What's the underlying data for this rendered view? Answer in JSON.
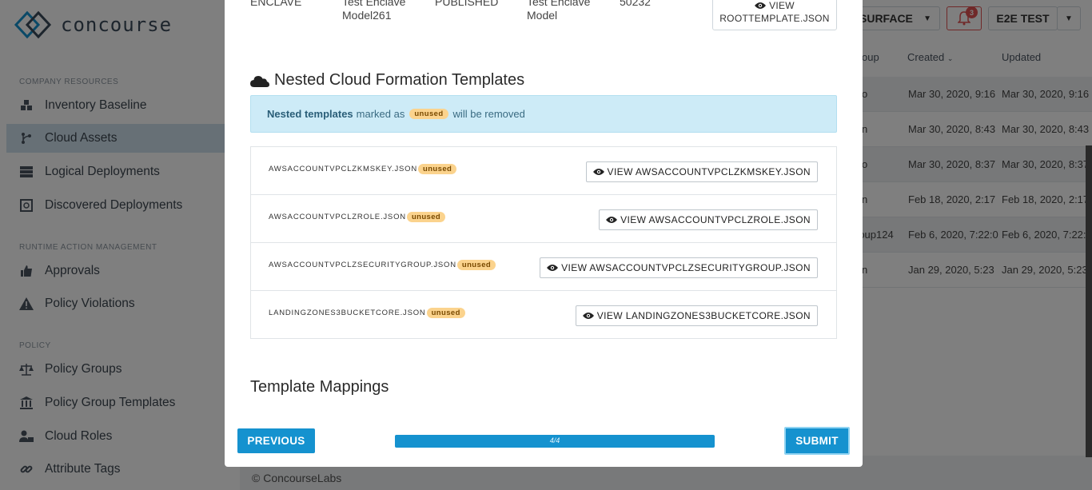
{
  "app": {
    "logo_text": "concourse"
  },
  "sidebar": {
    "sections": [
      {
        "title": "COMPANY RESOURCES"
      },
      {
        "title": "RUNTIME ACTION MANAGEMENT"
      },
      {
        "title": "POLICY"
      }
    ],
    "items": [
      {
        "label": "Inventory Baseline",
        "icon": "cubes-icon"
      },
      {
        "label": "Cloud Assets",
        "icon": "branch-icon",
        "active": true
      },
      {
        "label": "Logical Deployments",
        "icon": "server-icon"
      },
      {
        "label": "Discovered Deployments",
        "icon": "search-file-icon"
      },
      {
        "label": "Approvals",
        "icon": "thumbs-up-icon"
      },
      {
        "label": "Policy Violations",
        "icon": "warning-icon"
      },
      {
        "label": "Policy Groups",
        "icon": "scale-icon"
      },
      {
        "label": "Policy Group Templates",
        "icon": "bank-icon"
      },
      {
        "label": "Cloud Roles",
        "icon": "user-lock-icon"
      },
      {
        "label": "Attribute Tags",
        "icon": "link-icon"
      }
    ]
  },
  "header": {
    "surface_label": "SURFACE",
    "notification_count": "3",
    "user_label": "E2E TEST"
  },
  "table": {
    "columns": {
      "group_partial": "oup",
      "created": "Created",
      "updated": "Updated"
    },
    "rows": [
      {
        "group": "o",
        "created": "Mar 30, 2020, 9:16",
        "updated": "Mar 30, 2020, 9:16"
      },
      {
        "group": "n",
        "created": "Mar 30, 2020, 8:43",
        "updated": "Mar 30, 2020, 8:43"
      },
      {
        "group": "o",
        "created": "Mar 30, 2020, 8:37",
        "updated": "Mar 30, 2020, 8:37"
      },
      {
        "group": "n",
        "created": "Feb 18, 2020, 2:17",
        "updated": "Feb 18, 2020, 2:17"
      },
      {
        "group": "roup124",
        "created": "Feb 6, 2020, 7:22:0",
        "updated": "Feb 6, 2020, 7:22:0"
      },
      {
        "group": "n",
        "created": "Jan 29, 2020, 5:23",
        "updated": "Jan 29, 2020, 5:23"
      }
    ]
  },
  "footer": {
    "text": "© ConcourseLabs"
  },
  "modal": {
    "summary_row": {
      "type": "ENCLAVE",
      "name_line1": "Test Enclave",
      "name_line2": "Model261",
      "status": "PUBLISHED",
      "desc_line1": "Test Enclave",
      "desc_line2": "Model",
      "version": "50232",
      "view_line1": "VIEW",
      "view_line2": "ROOTTEMPLATE.JSON"
    },
    "nested_title": "Nested Cloud Formation Templates",
    "info": {
      "bold": "Nested templates",
      "pre": "marked as",
      "pill": "unused",
      "post": "will be removed"
    },
    "templates": [
      {
        "name": "AWSACCOUNTVPCLZKMSKEY.JSON",
        "tag": "unused",
        "button": "VIEW AWSACCOUNTVPCLZKMSKEY.JSON"
      },
      {
        "name": "AWSACCOUNTVPCLZROLE.JSON",
        "tag": "unused",
        "button": "VIEW AWSACCOUNTVPCLZROLE.JSON"
      },
      {
        "name": "AWSACCOUNTVPCLZSECURITYGROUP.JSON",
        "tag": "unused",
        "button": "VIEW AWSACCOUNTVPCLZSECURITYGROUP.JSON"
      },
      {
        "name": "LANDINGZONES3BUCKETCORE.JSON",
        "tag": "unused",
        "button": "VIEW LANDINGZONES3BUCKETCORE.JSON"
      }
    ],
    "mappings_title": "Template Mappings",
    "previous_label": "PREVIOUS",
    "progress_text": "4/4",
    "progress_fraction": 1.0,
    "submit_label": "SUBMIT"
  },
  "colors": {
    "accent": "#1592cf",
    "info_bg": "#cdebf7",
    "pill_bg": "#fbd38d",
    "alert": "#e05252"
  }
}
